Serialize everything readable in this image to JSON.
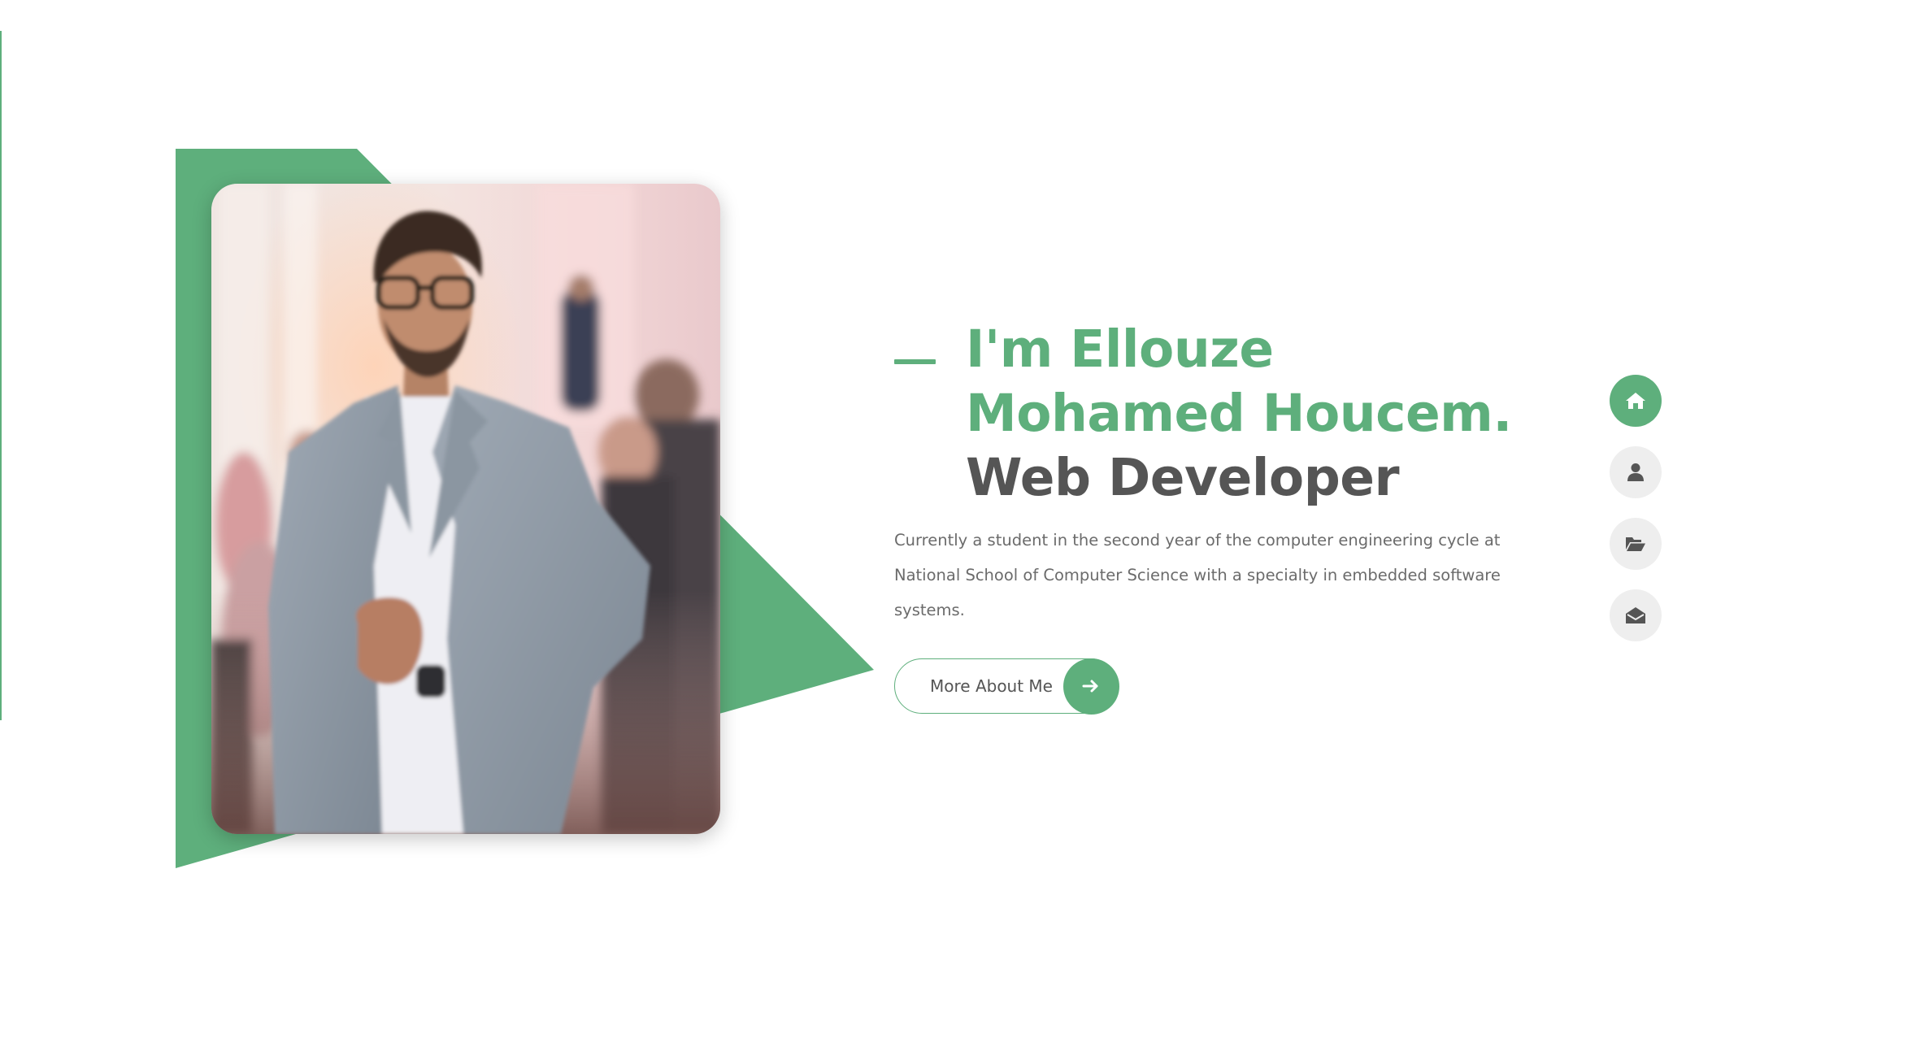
{
  "hero": {
    "title_line_1": "I'm Ellouze",
    "title_line_2": "Mohamed Houcem.",
    "title_line_3": "Web Developer",
    "intro": "Currently a student in the second year of the computer engineering cycle at National School of Computer Science with a specialty in embedded software systems.",
    "more_button_label": "More About Me",
    "more_button_icon": "arrow-right-icon",
    "photo_alt": "Portrait of Ellouze Mohamed Houcem"
  },
  "side_nav": {
    "items": [
      {
        "name": "home",
        "icon": "home-icon",
        "active": true
      },
      {
        "name": "about",
        "icon": "user-icon",
        "active": false
      },
      {
        "name": "portfolio",
        "icon": "folder-open-icon",
        "active": false
      },
      {
        "name": "contact",
        "icon": "envelope-open-icon",
        "active": false
      }
    ]
  },
  "colors": {
    "accent": "#5eaf7c",
    "heading_dark": "#555555",
    "body_text": "#6b6b6b",
    "nav_inactive_bg": "#eeeeee",
    "icon_dark": "#555555",
    "background": "#ffffff"
  }
}
